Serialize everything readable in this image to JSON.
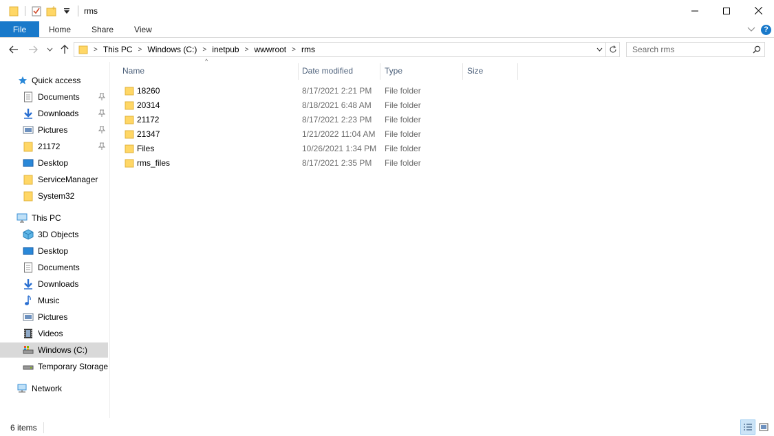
{
  "window": {
    "title": "rms",
    "icons": [
      "folder-icon",
      "properties-icon",
      "new-folder-icon",
      "customize-dropdown-icon",
      "minimize-icon",
      "maximize-icon",
      "close-icon"
    ]
  },
  "ribbon": {
    "tabs": [
      "File",
      "Home",
      "Share",
      "View"
    ],
    "file_color": "#1979ca"
  },
  "address": {
    "crumbs": [
      "This PC",
      "Windows (C:)",
      "inetpub",
      "wwwroot",
      "rms"
    ]
  },
  "search": {
    "placeholder": "Search rms"
  },
  "nav": {
    "quick_access": "Quick access",
    "quick_items": [
      "Documents",
      "Downloads",
      "Pictures",
      "21172",
      "Desktop",
      "ServiceManager",
      "System32"
    ],
    "this_pc": "This PC",
    "pc_items": [
      "3D Objects",
      "Desktop",
      "Documents",
      "Downloads",
      "Music",
      "Pictures",
      "Videos",
      "Windows (C:)",
      "Temporary Storage"
    ],
    "network": "Network",
    "selected": "Windows (C:)"
  },
  "columns": [
    "Name",
    "Date modified",
    "Type",
    "Size"
  ],
  "files": [
    {
      "name": "18260",
      "date": "8/17/2021 2:21 PM",
      "type": "File folder",
      "size": ""
    },
    {
      "name": "20314",
      "date": "8/18/2021 6:48 AM",
      "type": "File folder",
      "size": ""
    },
    {
      "name": "21172",
      "date": "8/17/2021 2:23 PM",
      "type": "File folder",
      "size": ""
    },
    {
      "name": "21347",
      "date": "1/21/2022 11:04 AM",
      "type": "File folder",
      "size": ""
    },
    {
      "name": "Files",
      "date": "10/26/2021 1:34 PM",
      "type": "File folder",
      "size": ""
    },
    {
      "name": "rms_files",
      "date": "8/17/2021 2:35 PM",
      "type": "File folder",
      "size": ""
    }
  ],
  "status": {
    "item_count": "6 items"
  }
}
